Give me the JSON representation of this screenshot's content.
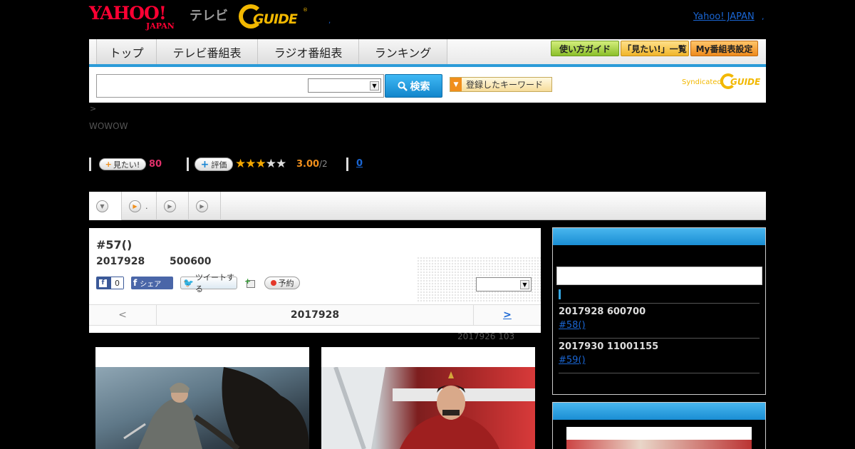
{
  "header": {
    "yahoo_logo": "YAHOO!",
    "yahoo_sub": "JAPAN",
    "tv_label": "テレビ",
    "gguide_logo": "GUIDE",
    "gguide_reg": "®",
    "dot": ",",
    "yahoo_japan_link": "Yahoo! JAPAN",
    "arrow": ","
  },
  "nav": {
    "tabs": [
      {
        "label": "トップ"
      },
      {
        "label": "テレビ番組表"
      },
      {
        "label": "ラジオ番組表"
      },
      {
        "label": "ランキング"
      }
    ],
    "buttons": [
      {
        "label": "使い方ガイド"
      },
      {
        "label": "「見たい!」一覧"
      },
      {
        "label": "My番組表設定"
      }
    ]
  },
  "search": {
    "input_value": "",
    "select_value": "",
    "button_label": "検索",
    "keyword_button": "登録したキーワード",
    "syndicated": "Syndicated",
    "synd_logo": "GUIDE"
  },
  "breadcrumb": ">",
  "channel": "WOWOW",
  "stats": {
    "mitai_label": "見たい!",
    "mitai_count": "80",
    "rate_label": "評価",
    "stars_filled": 3,
    "stars_total": 5,
    "score": "3.00",
    "score_max": "/2",
    "review_count": "0"
  },
  "tabs": [
    {
      "label": ""
    },
    {
      "label": "."
    },
    {
      "label": ""
    },
    {
      "label": ""
    }
  ],
  "program": {
    "title": "#57()",
    "date": "2017928",
    "time": "500600",
    "like_label": "0",
    "share_label": "シェア",
    "tweet_label": "ツイートする",
    "reserve_label": "予約",
    "select_value": "",
    "pager_prev": "<",
    "pager_current": "2017928",
    "pager_next": ">",
    "updated": "2017926  103"
  },
  "sidebar": {
    "items": [
      {
        "date": "2017928  600700",
        "link": "#58()"
      },
      {
        "date": "2017930  11001155",
        "link": "#59()"
      }
    ]
  },
  "colors": {
    "accent_blue": "#2b9bd8",
    "yahoo_red": "#ff0033",
    "gguide_yellow": "#f2b800",
    "mitai_pink": "#e0306a",
    "score_orange": "#f08f1c",
    "link_blue": "#1a66d4"
  }
}
